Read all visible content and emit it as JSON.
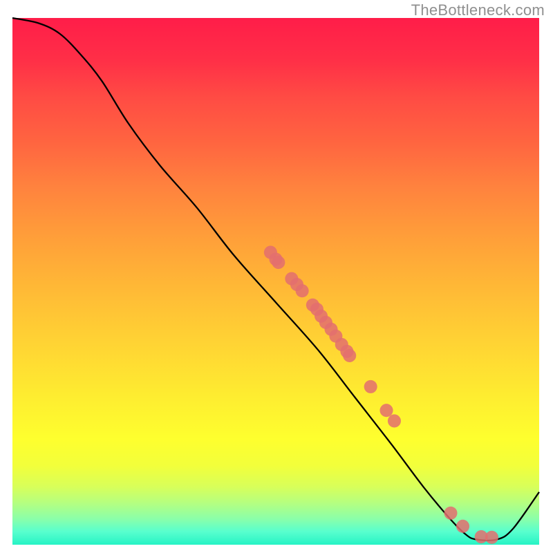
{
  "watermark": "TheBottleneck.com",
  "chart_data": {
    "type": "line",
    "title": "",
    "xlabel": "",
    "ylabel": "",
    "xlim": [
      0,
      100
    ],
    "ylim": [
      0,
      100
    ],
    "curve": [
      {
        "x": 0,
        "y": 100
      },
      {
        "x": 5,
        "y": 99
      },
      {
        "x": 9,
        "y": 97
      },
      {
        "x": 13,
        "y": 93
      },
      {
        "x": 17,
        "y": 88
      },
      {
        "x": 22,
        "y": 80
      },
      {
        "x": 28,
        "y": 72
      },
      {
        "x": 35,
        "y": 64
      },
      {
        "x": 42,
        "y": 55
      },
      {
        "x": 50,
        "y": 46
      },
      {
        "x": 58,
        "y": 37
      },
      {
        "x": 65,
        "y": 28
      },
      {
        "x": 72,
        "y": 19
      },
      {
        "x": 78,
        "y": 11
      },
      {
        "x": 83,
        "y": 5
      },
      {
        "x": 86,
        "y": 2
      },
      {
        "x": 88,
        "y": 1
      },
      {
        "x": 92,
        "y": 1
      },
      {
        "x": 95,
        "y": 3
      },
      {
        "x": 100,
        "y": 10
      }
    ],
    "markers": [
      {
        "x": 49.0,
        "y": 55.5
      },
      {
        "x": 50.0,
        "y": 54.2
      },
      {
        "x": 50.5,
        "y": 53.6
      },
      {
        "x": 53.0,
        "y": 50.5
      },
      {
        "x": 54.0,
        "y": 49.4
      },
      {
        "x": 55.0,
        "y": 48.2
      },
      {
        "x": 57.0,
        "y": 45.5
      },
      {
        "x": 57.8,
        "y": 44.7
      },
      {
        "x": 58.6,
        "y": 43.4
      },
      {
        "x": 59.5,
        "y": 42.2
      },
      {
        "x": 60.5,
        "y": 40.9
      },
      {
        "x": 61.4,
        "y": 39.6
      },
      {
        "x": 62.5,
        "y": 38.0
      },
      {
        "x": 63.5,
        "y": 36.7
      },
      {
        "x": 64.0,
        "y": 35.9
      },
      {
        "x": 68.0,
        "y": 30.0
      },
      {
        "x": 71.0,
        "y": 25.5
      },
      {
        "x": 72.5,
        "y": 23.5
      },
      {
        "x": 83.2,
        "y": 6.0
      },
      {
        "x": 85.5,
        "y": 3.5
      },
      {
        "x": 89.0,
        "y": 1.5
      },
      {
        "x": 91.0,
        "y": 1.4
      }
    ],
    "marker_radius_pct": 1.25,
    "marker_fill": "#e36f6e",
    "marker_fill_opacity": 0.85,
    "line_color": "#000000",
    "line_width": 2.3
  }
}
